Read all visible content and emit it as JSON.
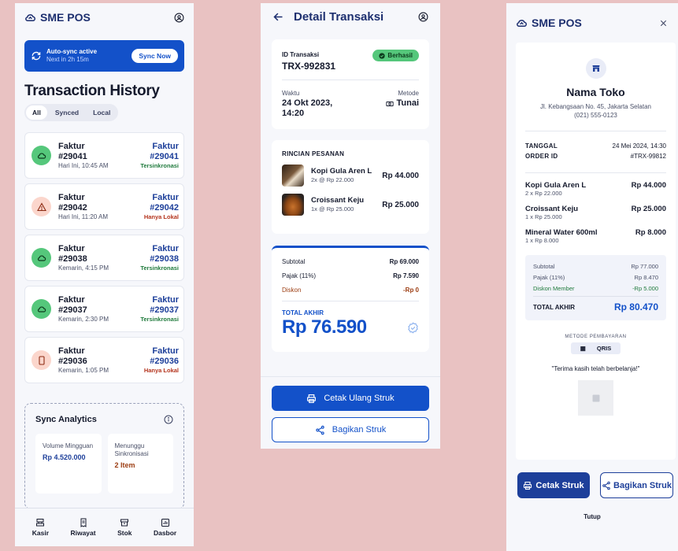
{
  "screen1": {
    "brand": "SME POS",
    "sync": {
      "title": "Auto-sync active",
      "subtitle": "Next in 2h 15m",
      "button": "Sync Now"
    },
    "heading": "Transaction History",
    "filters": [
      "All",
      "Synced",
      "Local"
    ],
    "transactions": [
      {
        "left_title": "Faktur",
        "left_id": "#29041",
        "time": "Hari Ini, 10:45 AM",
        "right_title": "Faktur",
        "right_id": "#29041",
        "status": "Tersinkronasi",
        "kind": "synced",
        "icon": "cloud-icon"
      },
      {
        "left_title": "Faktur",
        "left_id": "#29042",
        "time": "Hari Ini, 11:20 AM",
        "right_title": "Faktur",
        "right_id": "#29042",
        "status": "Hanya Lokal",
        "kind": "warning",
        "icon": "warning-icon"
      },
      {
        "left_title": "Faktur",
        "left_id": "#29038",
        "time": "Kemarin, 4:15 PM",
        "right_title": "Faktur",
        "right_id": "#29038",
        "status": "Tersinkronasi",
        "kind": "synced",
        "icon": "cloud-icon"
      },
      {
        "left_title": "Faktur",
        "left_id": "#29037",
        "time": "Kemarin, 2:30 PM",
        "right_title": "Faktur",
        "right_id": "#29037",
        "status": "Tersinkronasi",
        "kind": "synced",
        "icon": "cloud-icon"
      },
      {
        "left_title": "Faktur",
        "left_id": "#29036",
        "time": "Kemarin, 1:05 PM",
        "right_title": "Faktur",
        "right_id": "#29036",
        "status": "Hanya Lokal",
        "kind": "local",
        "icon": "phone-icon"
      }
    ],
    "analytics": {
      "title": "Sync Analytics",
      "weekly_label": "Volume Mingguan",
      "weekly_value": "Rp 4.520.000",
      "pending_label": "Menunggu Sinkronisasi",
      "pending_value": "2 Item"
    },
    "tabs": [
      "Kasir",
      "Riwayat",
      "Stok",
      "Dasbor"
    ]
  },
  "screen2": {
    "title": "Detail Transaksi",
    "id_label": "ID Transaksi",
    "id_value": "TRX-992831",
    "status": "Berhasil",
    "time_label": "Waktu",
    "time_value": "24 Okt 2023, 14:20",
    "method_label": "Metode",
    "method_value": "Tunai",
    "order_heading": "RINCIAN PESANAN",
    "items": [
      {
        "name": "Kopi Gula Aren L",
        "qty": "2x @ Rp 22.000",
        "price": "Rp 44.000"
      },
      {
        "name": "Croissant Keju",
        "qty": "1x @ Rp 25.000",
        "price": "Rp 25.000"
      }
    ],
    "subtotal_label": "Subtotal",
    "subtotal_value": "Rp 69.000",
    "tax_label": "Pajak (11%)",
    "tax_value": "Rp 7.590",
    "discount_label": "Diskon",
    "discount_value": "-Rp 0",
    "total_label": "TOTAL AKHIR",
    "total_value": "Rp 76.590",
    "reprint_button": "Cetak Ulang Struk",
    "share_button": "Bagikan Struk"
  },
  "screen3": {
    "brand": "SME POS",
    "store_name": "Nama Toko",
    "address": "Jl. Kebangsaan No. 45, Jakarta Selatan",
    "phone": "(021) 555-0123",
    "date_label": "TANGGAL",
    "date_value": "24 Mei 2024, 14:30",
    "order_label": "ORDER ID",
    "order_value": "#TRX-99812",
    "items": [
      {
        "name": "Kopi Gula Aren L",
        "qty": "2 x Rp 22.000",
        "price": "Rp 44.000"
      },
      {
        "name": "Croissant Keju",
        "qty": "1 x Rp 25.000",
        "price": "Rp 25.000"
      },
      {
        "name": "Mineral Water 600ml",
        "qty": "1 x Rp 8.000",
        "price": "Rp 8.000"
      }
    ],
    "subtotal_label": "Subtotal",
    "subtotal_value": "Rp 77.000",
    "tax_label": "Pajak (11%)",
    "tax_value": "Rp 8.470",
    "discount_label": "Diskon Member",
    "discount_value": "-Rp 5.000",
    "total_label": "TOTAL AKHIR",
    "total_value": "Rp 80.470",
    "payment_label": "METODE PEMBAYARAN",
    "payment_value": "QRIS",
    "thanks": "\"Terima kasih telah berbelanja!\"",
    "print_button": "Cetak Struk",
    "share_button": "Bagikan Struk",
    "close_button": "Tutup"
  },
  "colors": {
    "primary": "#1351c9",
    "navy": "#1d3f9a",
    "success": "#55c77b",
    "danger": "#b4341d",
    "background": "#e9c2c2"
  }
}
